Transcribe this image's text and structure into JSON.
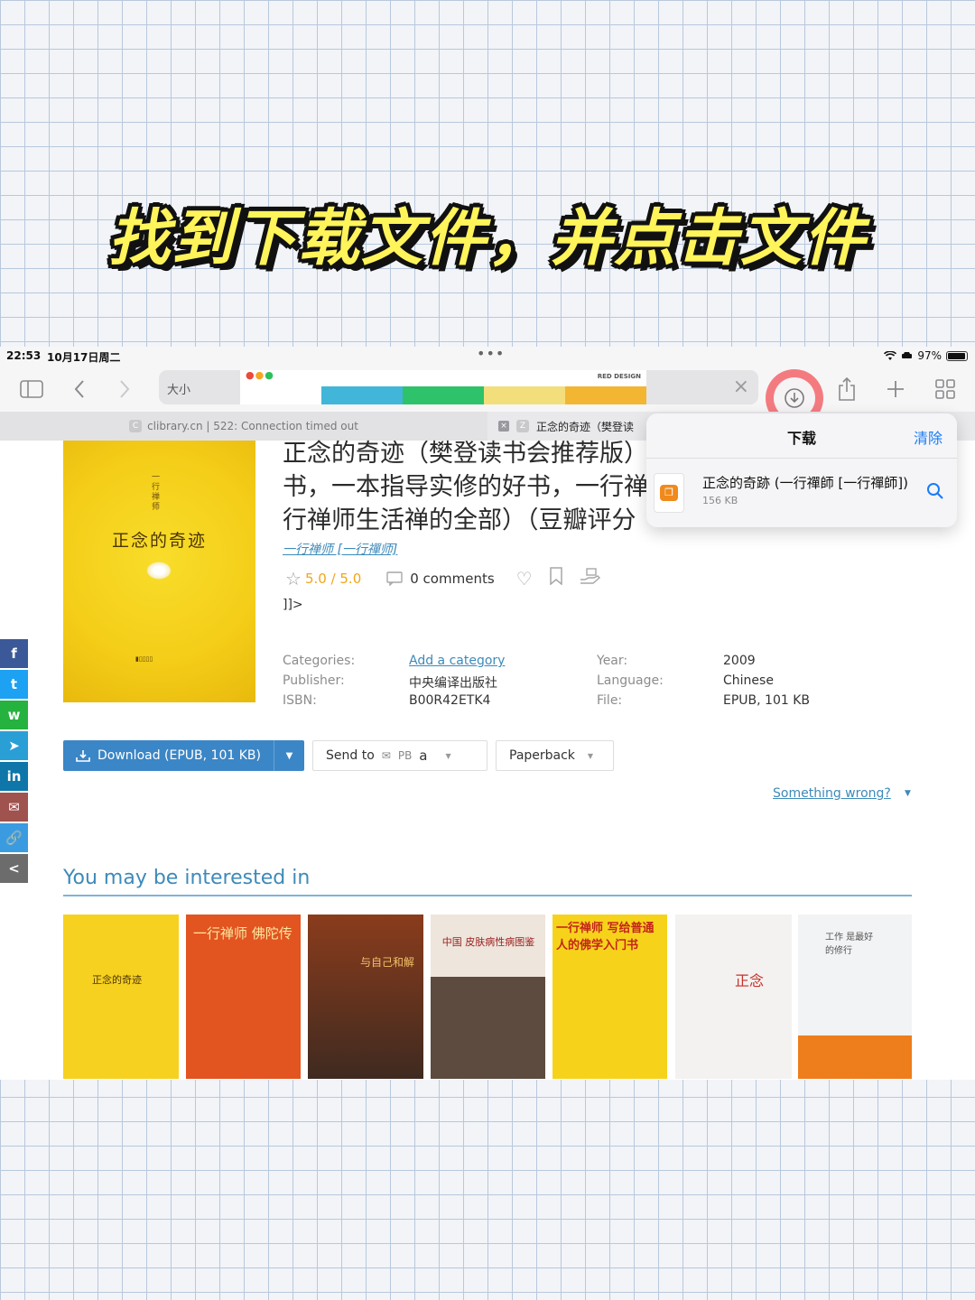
{
  "headline": "找到下载文件，并点击文件",
  "status_bar": {
    "time": "22:53",
    "date": "10月17日周二",
    "battery": "97%"
  },
  "toolbar": {
    "zoom_label": "大小",
    "thumbnail_brand": "RED DESIGN"
  },
  "tabs": [
    {
      "favicon": "C",
      "title": "clibrary.cn | 522: Connection timed out",
      "active": false
    },
    {
      "favicon": "Z",
      "title": "正念的奇迹（樊登读",
      "active": true
    }
  ],
  "book": {
    "cover_vertical_title": "一行禅师",
    "cover_title": "正念的奇迹",
    "title_lines": [
      "正念的奇迹（樊登读书会推荐版）",
      "书，一本指导实修的好书，一行禅",
      "行禅师生活禅的全部）（豆瓣评分"
    ],
    "author": "一行禅师 [一行禪师]",
    "rating": "5.0",
    "rating_max": "5.0",
    "comments": "0 comments",
    "cdata_fragment": "]]>",
    "categories_label": "Categories:",
    "categories_value": "Add a category",
    "publisher_label": "Publisher:",
    "publisher_value": "中央编译出版社",
    "isbn_label": "ISBN:",
    "isbn_value": "B00R42ETK4",
    "year_label": "Year:",
    "year_value": "2009",
    "language_label": "Language:",
    "language_value": "Chinese",
    "file_label": "File:",
    "file_value": "EPUB, 101 KB"
  },
  "actions": {
    "download_label": "Download (EPUB, 101 KB)",
    "send_to_label": "Send to",
    "send_to_targets": "PB",
    "paperback_label": "Paperback",
    "something_wrong": "Something wrong?"
  },
  "social_buttons": [
    {
      "name": "facebook",
      "glyph": "f",
      "color": "#3b5998"
    },
    {
      "name": "twitter",
      "glyph": "t",
      "color": "#1da1f2"
    },
    {
      "name": "whatsapp",
      "glyph": "w",
      "color": "#25b23f"
    },
    {
      "name": "telegram",
      "glyph": "➤",
      "color": "#2a9fd6"
    },
    {
      "name": "linkedin",
      "glyph": "in",
      "color": "#0e76a8"
    },
    {
      "name": "email",
      "glyph": "✉",
      "color": "#a0524e"
    },
    {
      "name": "copy-link",
      "glyph": "🔗",
      "color": "#3b9be0"
    },
    {
      "name": "share",
      "glyph": "<",
      "color": "#6c6c6c"
    }
  ],
  "recommendations": {
    "heading": "You may be interested in",
    "books": [
      {
        "title": "正念的奇迹",
        "bg": "#f6d11f"
      },
      {
        "title": "一行禅师 佛陀传",
        "bg": "#e25420"
      },
      {
        "title": "与自己和解",
        "bg": "#7a3b20"
      },
      {
        "title": "中国 皮肤病性病图鉴",
        "bg": "#5c4b3e"
      },
      {
        "title": "一行禅师 写给普通人的佛学入门书",
        "bg": "#f6d31a"
      },
      {
        "title": "正念",
        "bg": "#f4f2f0"
      },
      {
        "title": "工作 是最好的修行",
        "bg": "#f2f3f5"
      }
    ]
  },
  "downloads_popover": {
    "title": "下载",
    "clear_label": "清除",
    "file_name": "正念的奇跡 (一行禪師 [一行禪師])",
    "file_size": "156 KB"
  }
}
